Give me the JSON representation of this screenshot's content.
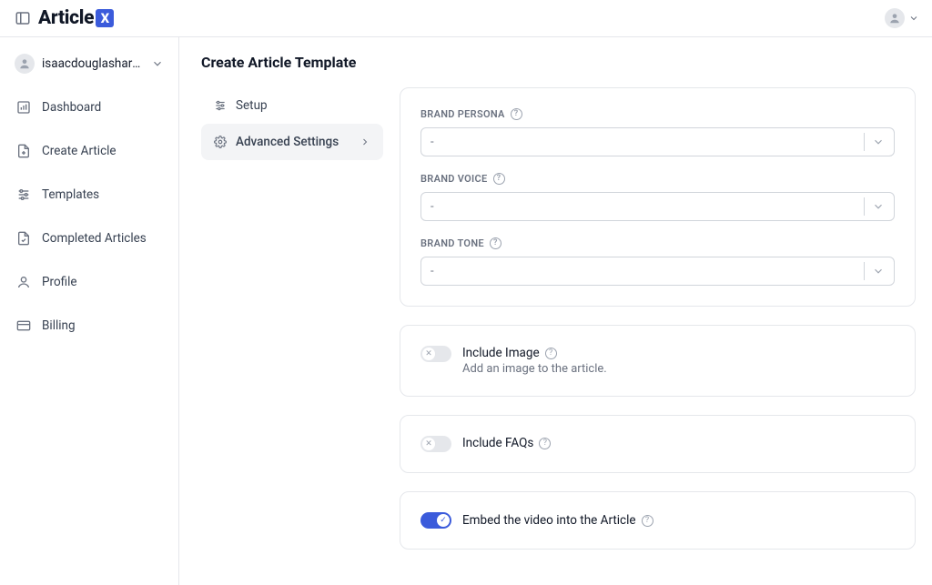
{
  "brand": {
    "name": "Article",
    "suffix": "X"
  },
  "user": {
    "name": "isaacdouglasharmon..."
  },
  "sidebar": {
    "items": [
      {
        "label": "Dashboard"
      },
      {
        "label": "Create Article"
      },
      {
        "label": "Templates"
      },
      {
        "label": "Completed Articles"
      },
      {
        "label": "Profile"
      },
      {
        "label": "Billing"
      }
    ]
  },
  "page": {
    "title": "Create Article Template"
  },
  "subnav": {
    "items": [
      {
        "label": "Setup"
      },
      {
        "label": "Advanced Settings"
      }
    ]
  },
  "form": {
    "brand_persona": {
      "label": "Brand Persona",
      "value": "-"
    },
    "brand_voice": {
      "label": "Brand Voice",
      "value": "-"
    },
    "brand_tone": {
      "label": "Brand Tone",
      "value": "-"
    }
  },
  "toggles": {
    "include_image": {
      "title": "Include Image",
      "subtitle": "Add an image to the article.",
      "on": false
    },
    "include_faqs": {
      "title": "Include FAQs",
      "on": false
    },
    "embed_video": {
      "title": "Embed the video into the Article",
      "on": true
    }
  }
}
